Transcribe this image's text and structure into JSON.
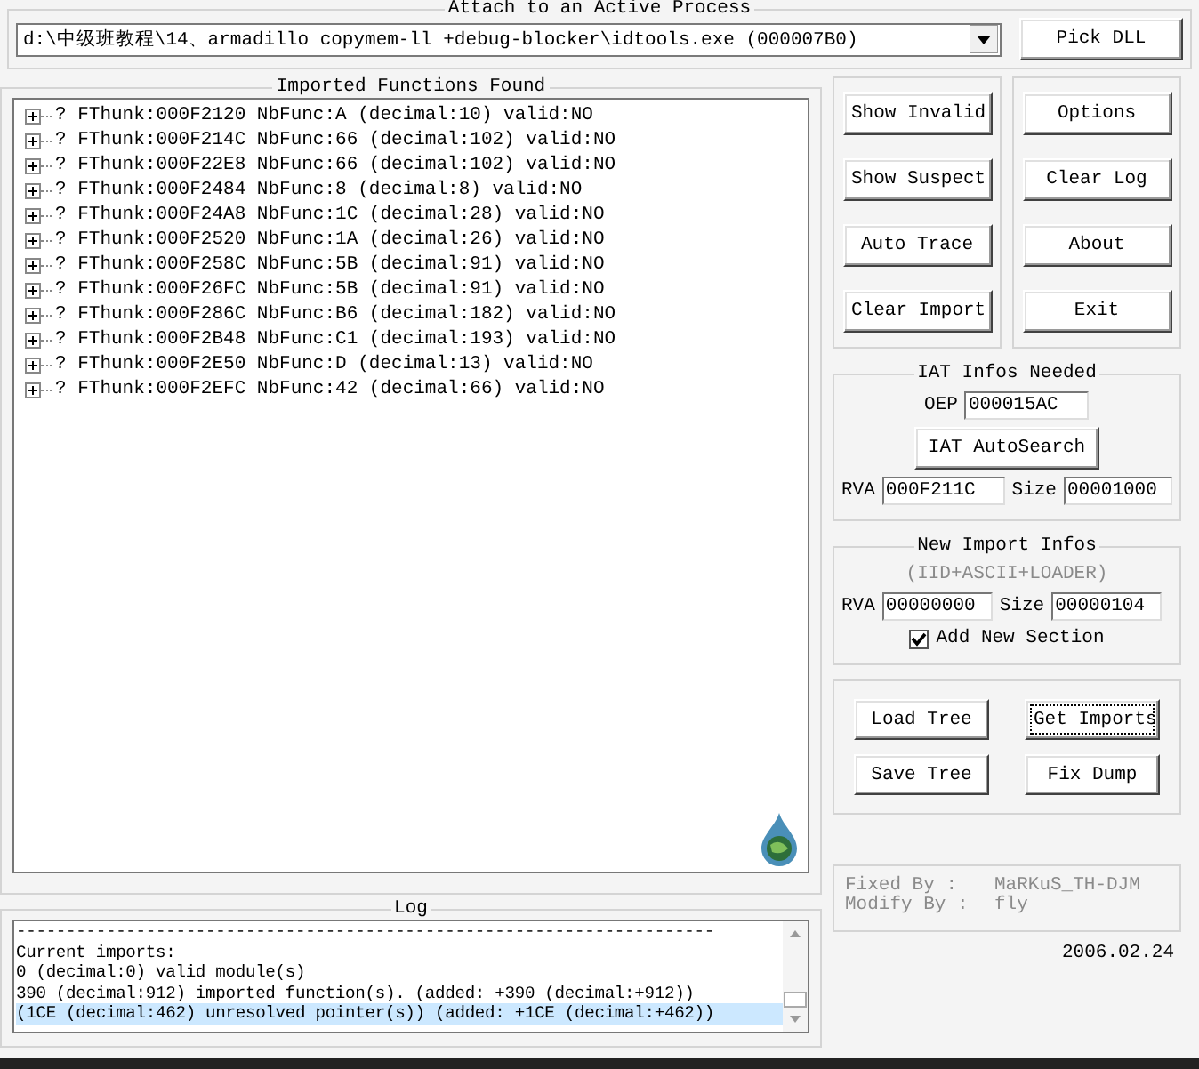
{
  "attach": {
    "title": "Attach to an Active Process",
    "process": "d:\\中级班教程\\14、armadillo copymem-ll +debug-blocker\\idtools.exe (000007B0)",
    "pick_button": "Pick DLL"
  },
  "imports": {
    "title": "Imported Functions Found",
    "items": [
      {
        "label": "? FThunk:000F2120 NbFunc:A (decimal:10) valid:NO",
        "expanded": false
      },
      {
        "label": "? FThunk:000F214C NbFunc:66 (decimal:102) valid:NO",
        "expanded": false
      },
      {
        "label": "? FThunk:000F22E8 NbFunc:66 (decimal:102) valid:NO",
        "expanded": false
      },
      {
        "label": "? FThunk:000F2484 NbFunc:8 (decimal:8) valid:NO",
        "expanded": false
      },
      {
        "label": "? FThunk:000F24A8 NbFunc:1C (decimal:28) valid:NO",
        "expanded": false
      },
      {
        "label": "? FThunk:000F2520 NbFunc:1A (decimal:26) valid:NO",
        "expanded": false
      },
      {
        "label": "? FThunk:000F258C NbFunc:5B (decimal:91) valid:NO",
        "expanded": false
      },
      {
        "label": "? FThunk:000F26FC NbFunc:5B (decimal:91) valid:NO",
        "expanded": false
      },
      {
        "label": "? FThunk:000F286C NbFunc:B6 (decimal:182) valid:NO",
        "expanded": false
      },
      {
        "label": "? FThunk:000F2B48 NbFunc:C1 (decimal:193) valid:NO",
        "expanded": false
      },
      {
        "label": "? FThunk:000F2E50 NbFunc:D (decimal:13) valid:NO",
        "expanded": false
      },
      {
        "label": "? FThunk:000F2EFC NbFunc:42 (decimal:66) valid:NO",
        "expanded": false
      }
    ]
  },
  "log": {
    "title": "Log",
    "lines": [
      {
        "text": "----------------------------------------------------------------------",
        "selected": false
      },
      {
        "text": "Current imports:",
        "selected": false
      },
      {
        "text": "0 (decimal:0) valid module(s)",
        "selected": false
      },
      {
        "text": "390 (decimal:912) imported function(s). (added: +390 (decimal:+912))",
        "selected": false
      },
      {
        "text": "(1CE (decimal:462) unresolved pointer(s)) (added: +1CE (decimal:+462))",
        "selected": true
      }
    ]
  },
  "buttons_left": [
    "Show Invalid",
    "Show Suspect",
    "Auto Trace",
    "Clear Import"
  ],
  "buttons_right": [
    "Options",
    "Clear Log",
    "About",
    "Exit"
  ],
  "iat": {
    "title": "IAT Infos Needed",
    "oep_label": "OEP",
    "oep": "000015AC",
    "autosearch_button": "IAT AutoSearch",
    "rva_label": "RVA",
    "rva": "000F211C",
    "size_label": "Size",
    "size": "00001000"
  },
  "new_import": {
    "title": "New Import Infos",
    "note": "(IID+ASCII+LOADER)",
    "rva_label": "RVA",
    "rva": "00000000",
    "size_label": "Size",
    "size": "00000104",
    "add_section": {
      "label": "Add New Section",
      "checked": true
    }
  },
  "tree_buttons": [
    {
      "label": "Load Tree",
      "focused": false
    },
    {
      "label": "Get Imports",
      "focused": true
    },
    {
      "label": "Save Tree",
      "focused": false
    },
    {
      "label": "Fix Dump",
      "focused": false
    }
  ],
  "credits": {
    "lines": [
      {
        "label": "Fixed By :",
        "value": "MaRKuS_TH-DJM"
      },
      {
        "label": "Modify By :",
        "value": "fly"
      }
    ]
  },
  "date": "2006.02.24"
}
